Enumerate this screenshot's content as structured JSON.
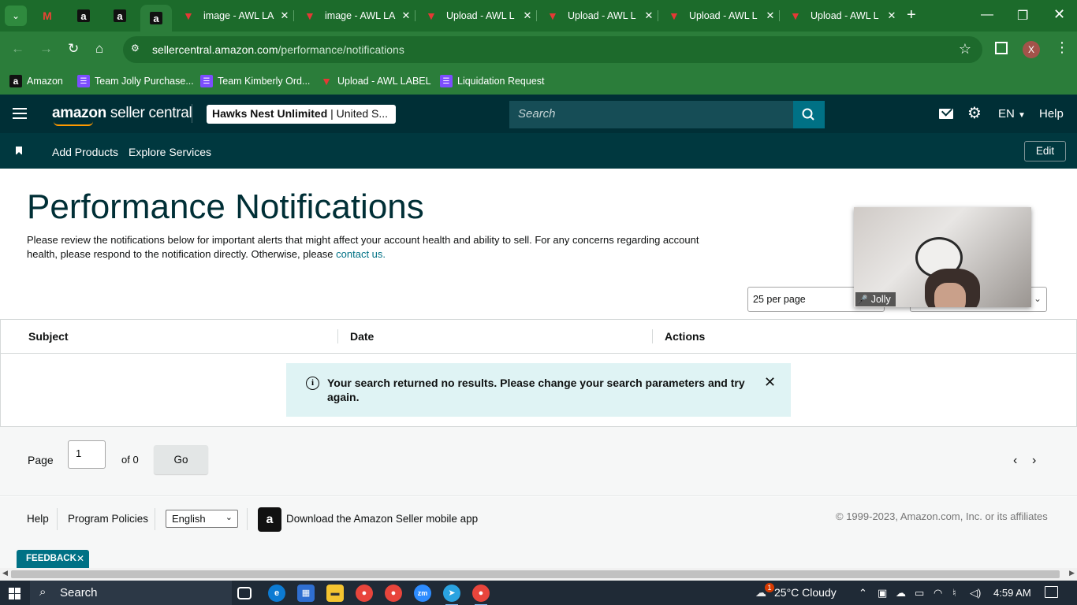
{
  "browser": {
    "tabs": [
      {
        "title": "image - AWL LA",
        "favicon": "awl-icon"
      },
      {
        "title": "image - AWL LA",
        "favicon": "awl-icon"
      },
      {
        "title": "Upload - AWL L",
        "favicon": "awl-icon"
      },
      {
        "title": "Upload - AWL L",
        "favicon": "awl-icon"
      },
      {
        "title": "Upload - AWL L",
        "favicon": "awl-icon"
      },
      {
        "title": "Upload - AWL L",
        "favicon": "awl-icon"
      }
    ],
    "pinned_tab_icons": [
      "gmail-icon",
      "amazon-icon",
      "amazon-icon",
      "amazon-icon"
    ],
    "url_host": "sellercentral.amazon.com",
    "url_path": "/performance/notifications",
    "profile_initial": "X",
    "bookmarks": [
      {
        "label": "Amazon",
        "icon": "amazon-icon"
      },
      {
        "label": "Team Jolly Purchase...",
        "icon": "list-icon"
      },
      {
        "label": "Team Kimberly Ord...",
        "icon": "list-icon"
      },
      {
        "label": "Upload - AWL LABEL",
        "icon": "awl-icon"
      },
      {
        "label": "Liquidation Request",
        "icon": "list-icon"
      }
    ]
  },
  "header": {
    "logo_text_a": "amazon",
    "logo_text_b": " seller central",
    "account_name": "Hawks Nest Unlimited",
    "account_region": " | United S...",
    "search_placeholder": "Search",
    "language": "EN",
    "help": "Help"
  },
  "subnav": {
    "links": [
      "Add Products",
      "Explore Services"
    ],
    "edit": "Edit"
  },
  "page": {
    "title": "Performance Notifications",
    "intro": "Please review the notifications below for important alerts that might affect your account health and ability to sell. For any concerns regarding account health, please respond to the notification directly. Otherwise, please ",
    "intro_link": "contact us.",
    "per_page": "25 per page"
  },
  "video_overlay": {
    "name": "Jolly"
  },
  "table": {
    "columns": [
      "Subject",
      "Date",
      "Actions"
    ],
    "empty_message": "Your search returned no results. Please change your search parameters and try again."
  },
  "pager": {
    "page_label": "Page",
    "page_value": "1",
    "of_label": "of 0",
    "go": "Go"
  },
  "footer": {
    "help": "Help",
    "program_policies": "Program Policies",
    "language": "English",
    "app_text": "Download the Amazon Seller mobile app",
    "copyright": "© 1999-2023, Amazon.com, Inc. or its affiliates",
    "feedback": "FEEDBACK"
  },
  "taskbar": {
    "search": "Search",
    "weather": "25°C  Cloudy",
    "weather_badge": "1",
    "time": "4:59 AM"
  },
  "colors": {
    "chrome_green": "#2b7d3a",
    "sc_header": "#002f36",
    "link": "#007185",
    "alert_bg": "#dff3f4"
  }
}
